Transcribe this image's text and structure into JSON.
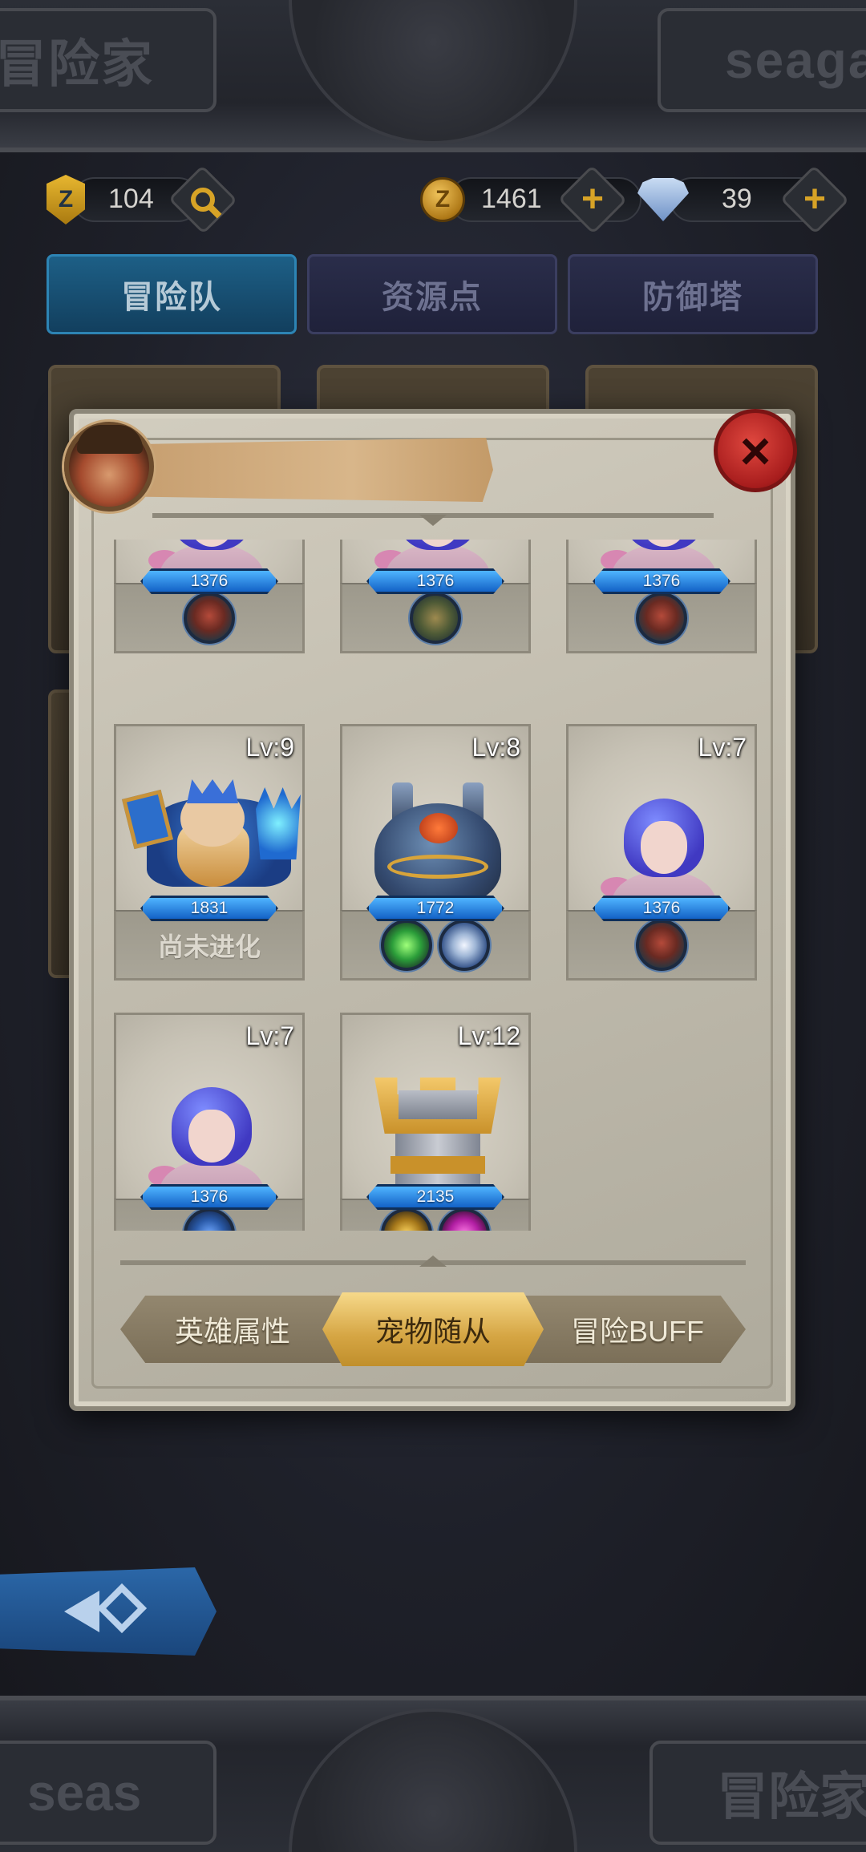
{
  "header_banner": {
    "left_text": "冒险家",
    "right_text": "seaga"
  },
  "footer_banner": {
    "left_text": "seas",
    "right_text": "冒险家"
  },
  "resources": {
    "badge": {
      "icon": "z-badge-icon",
      "value": "104",
      "action_icon": "search-icon"
    },
    "coins": {
      "icon": "gold-coin-icon",
      "value": "1461",
      "action_icon": "plus-icon"
    },
    "shells": {
      "icon": "shell-icon",
      "value": "39",
      "action_icon": "plus-icon"
    }
  },
  "tabs": [
    {
      "label": "冒险队",
      "active": true
    },
    {
      "label": "资源点",
      "active": false
    },
    {
      "label": "防御塔",
      "active": false
    }
  ],
  "modal": {
    "hero_avatar": "pirate-hero-avatar",
    "close_icon": "close-x-icon",
    "pets": [
      {
        "level": "",
        "power": "1376",
        "creature": "blue-hair-girl",
        "skills": [
          "bandit"
        ]
      },
      {
        "level": "",
        "power": "1376",
        "creature": "blue-hair-girl",
        "skills": [
          "rock"
        ]
      },
      {
        "level": "",
        "power": "1376",
        "creature": "blue-hair-girl",
        "skills": [
          "bandit"
        ]
      },
      {
        "level": "Lv:9",
        "power": "1831",
        "creature": "ice-king",
        "skills": [],
        "status": "尚未进化"
      },
      {
        "level": "Lv:8",
        "power": "1772",
        "creature": "steam-bot",
        "skills": [
          "heal",
          "shield"
        ]
      },
      {
        "level": "Lv:7",
        "power": "1376",
        "creature": "blue-hair-girl",
        "skills": [
          "bandit"
        ]
      },
      {
        "level": "Lv:7",
        "power": "1376",
        "creature": "blue-hair-girl",
        "skills": [
          "seal"
        ]
      },
      {
        "level": "Lv:12",
        "power": "2135",
        "creature": "gold-tower",
        "skills": [
          "gold",
          "magenta"
        ]
      }
    ],
    "bottom_tabs": [
      {
        "label": "英雄属性",
        "active": false
      },
      {
        "label": "宠物随从",
        "active": true
      },
      {
        "label": "冒险BUFF",
        "active": false
      }
    ]
  },
  "colors": {
    "accent_gold": "#d5a543",
    "power_blue": "#1f7be0",
    "close_red": "#c0262a",
    "active_tab": "#1d5f86"
  }
}
